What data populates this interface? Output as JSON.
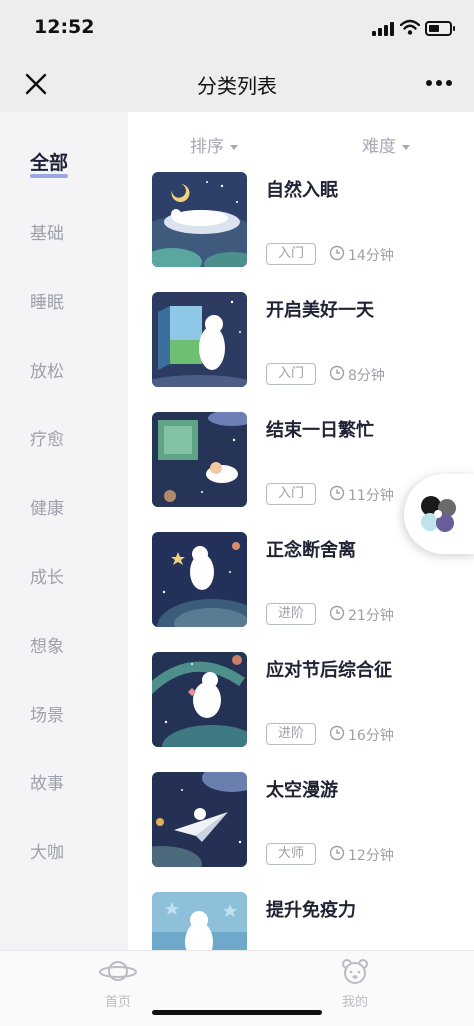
{
  "status_bar": {
    "time": "12:52"
  },
  "nav": {
    "title": "分类列表",
    "close_icon": "close-icon",
    "more_icon": "more-icon"
  },
  "sidebar": {
    "items": [
      {
        "label": "全部",
        "active": true
      },
      {
        "label": "基础"
      },
      {
        "label": "睡眠"
      },
      {
        "label": "放松"
      },
      {
        "label": "疗愈"
      },
      {
        "label": "健康"
      },
      {
        "label": "成长"
      },
      {
        "label": "想象"
      },
      {
        "label": "场景"
      },
      {
        "label": "故事"
      },
      {
        "label": "大咖"
      }
    ]
  },
  "filters": {
    "sort_label": "排序",
    "difficulty_label": "难度"
  },
  "courses": [
    {
      "title": "自然入眠",
      "level": "入门",
      "duration": "14分钟"
    },
    {
      "title": "开启美好一天",
      "level": "入门",
      "duration": "8分钟"
    },
    {
      "title": "结束一日繁忙",
      "level": "入门",
      "duration": "11分钟"
    },
    {
      "title": "正念断舍离",
      "level": "进阶",
      "duration": "21分钟"
    },
    {
      "title": "应对节后综合征",
      "level": "进阶",
      "duration": "16分钟"
    },
    {
      "title": "太空漫游",
      "level": "大师",
      "duration": "12分钟"
    },
    {
      "title": "提升免疫力",
      "level": "",
      "duration": ""
    }
  ],
  "tab_bar": {
    "items": [
      {
        "label": "首页",
        "icon": "planet-icon"
      },
      {
        "label": "我的",
        "icon": "bear-face-icon"
      }
    ]
  },
  "colors": {
    "accent_underline": "#9aa8e6",
    "muted_text": "#9ca0a9",
    "nav_bg": "#ededed",
    "sidebar_bg": "#f4f4f6"
  }
}
